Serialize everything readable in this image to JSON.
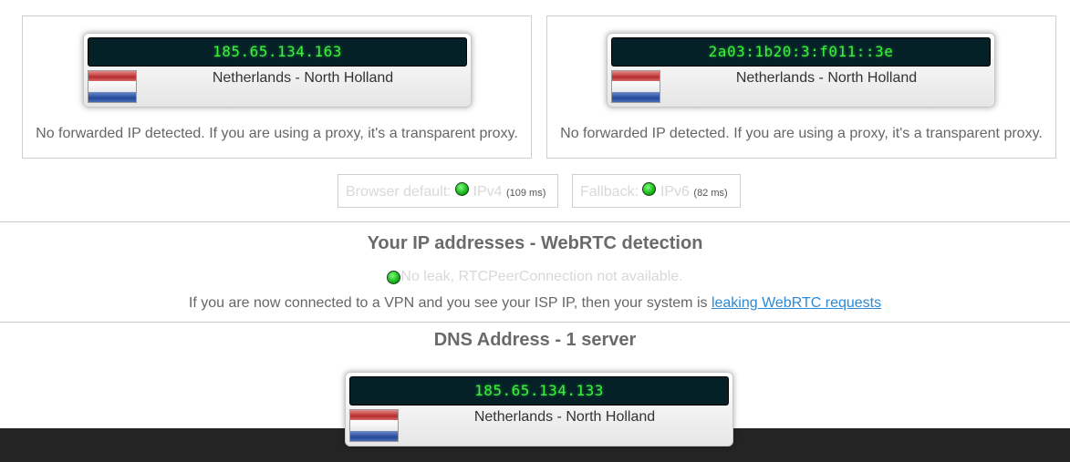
{
  "ip_panels": [
    {
      "ip": "185.65.134.163",
      "location": "Netherlands - North Holland",
      "flag": "netherlands-flag",
      "note": "No forwarded IP detected. If you are using a proxy, it's a transparent proxy."
    },
    {
      "ip": "2a03:1b20:3:f011::3e",
      "location": "Netherlands - North Holland",
      "flag": "netherlands-flag",
      "note": "No forwarded IP detected. If you are using a proxy, it's a transparent proxy."
    }
  ],
  "protocols": {
    "default": {
      "label": "Browser default:",
      "protocol": "IPv4",
      "latency": "(109 ms)"
    },
    "fallback": {
      "label": "Fallback:",
      "protocol": "IPv6",
      "latency": "(82 ms)"
    }
  },
  "webrtc": {
    "title": "Your IP addresses - WebRTC detection",
    "status": "No leak, RTCPeerConnection not available.",
    "note_prefix": "If you are now connected to a VPN and you see your ISP IP, then your system is ",
    "link_text": "leaking WebRTC requests"
  },
  "dns": {
    "title": "DNS Address - 1 server",
    "server": {
      "ip": "185.65.134.133",
      "location": "Netherlands - North Holland",
      "flag": "netherlands-flag"
    }
  },
  "colors": {
    "status_ok": "#16b416",
    "ip_text": "#3cf03c",
    "ip_background": "#062028",
    "link": "#2a8ad8",
    "footer": "#242424"
  }
}
